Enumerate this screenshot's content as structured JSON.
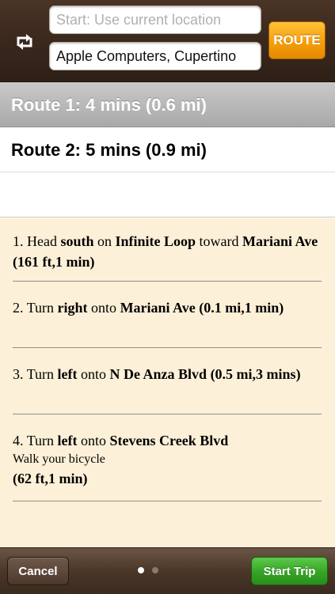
{
  "colors": {
    "topbar": "#3a281d",
    "route_button": "#f59e0a",
    "start_button": "#35a325",
    "directions_bg": "#fdf0d8",
    "selected_route": "#b5b5b5"
  },
  "header": {
    "swap_icon": "swap-arrows-icon",
    "start_placeholder": "Start: Use current location",
    "destination_value": "Apple Computers, Cupertino",
    "route_label": "ROUTE"
  },
  "routes": [
    {
      "label": "Route 1: 4 mins (0.6 mi)",
      "selected": true
    },
    {
      "label": "Route 2: 5 mins (0.9 mi)",
      "selected": false
    }
  ],
  "steps": [
    {
      "num": "1.",
      "verb": "Head",
      "dir": "south",
      "prep": "on",
      "road": "Infinite Loop",
      "extra": "toward",
      "road2": "Mariani Ave",
      "detail": "(161 ft,1 min)"
    },
    {
      "num": "2.",
      "verb": "Turn",
      "dir": "right",
      "prep": "onto",
      "road": "Mariani Ave",
      "detail": "(0.1 mi,1 min)"
    },
    {
      "num": "3.",
      "verb": "Turn",
      "dir": "left",
      "prep": "onto",
      "road": "N De Anza Blvd",
      "detail": "(0.5 mi,3 mins)"
    },
    {
      "num": "4.",
      "verb": "Turn",
      "dir": "left",
      "prep": "onto",
      "road": "Stevens Creek Blvd",
      "note": "Walk your bicycle",
      "detail": "(62 ft,1 min)"
    }
  ],
  "footer": {
    "cancel_label": "Cancel",
    "start_label": "Start Trip",
    "page_count": 2,
    "active_page": 1
  }
}
